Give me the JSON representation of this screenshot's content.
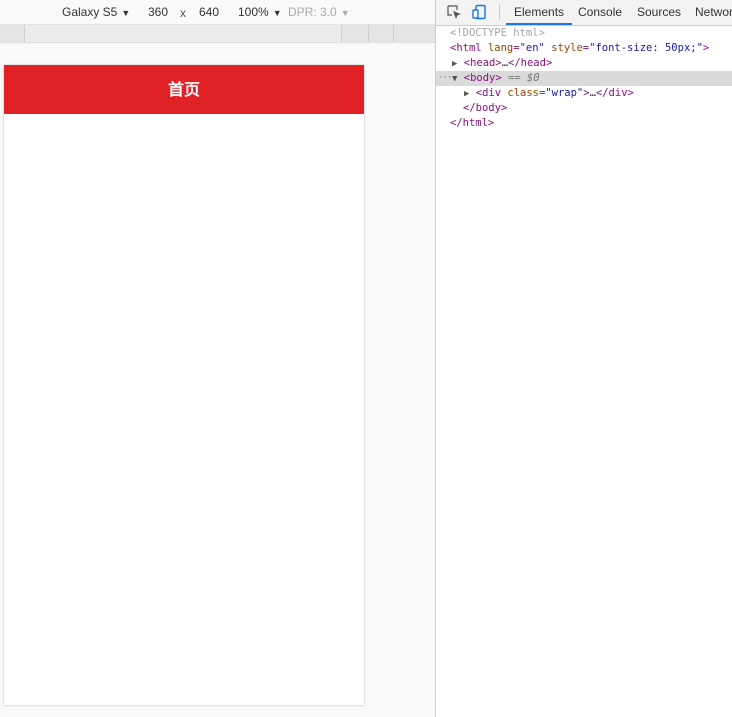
{
  "emulation": {
    "device": "Galaxy S5",
    "width": "360",
    "times": "x",
    "height": "640",
    "zoom": "100%",
    "dpr": "DPR: 3.0"
  },
  "page": {
    "header_title": "首页",
    "header_color": "#e02125"
  },
  "devtools": {
    "tabs": [
      {
        "label": "Elements",
        "active": true
      },
      {
        "label": "Console",
        "active": false
      },
      {
        "label": "Sources",
        "active": false
      },
      {
        "label": "Network",
        "active": false
      }
    ],
    "dom": {
      "doctype": "<!DOCTYPE html>",
      "html_open_tag": "<html",
      "html_attr_lang": "lang",
      "html_lang_value": "\"en\"",
      "html_attr_style": "style",
      "html_style_value": "\"font-size: 50px;\"",
      "html_open_close": ">",
      "head_open": "<head>",
      "head_ellipsis": "…",
      "head_close": "</head>",
      "body_open": "<body>",
      "body_marker": "== $0",
      "div_open": "<div",
      "div_attr_class": "class",
      "div_class_value": "\"wrap\"",
      "div_open_close": ">",
      "div_ellipsis": "…",
      "div_close": "</div>",
      "body_close": "</body>",
      "html_close": "</html>"
    }
  }
}
